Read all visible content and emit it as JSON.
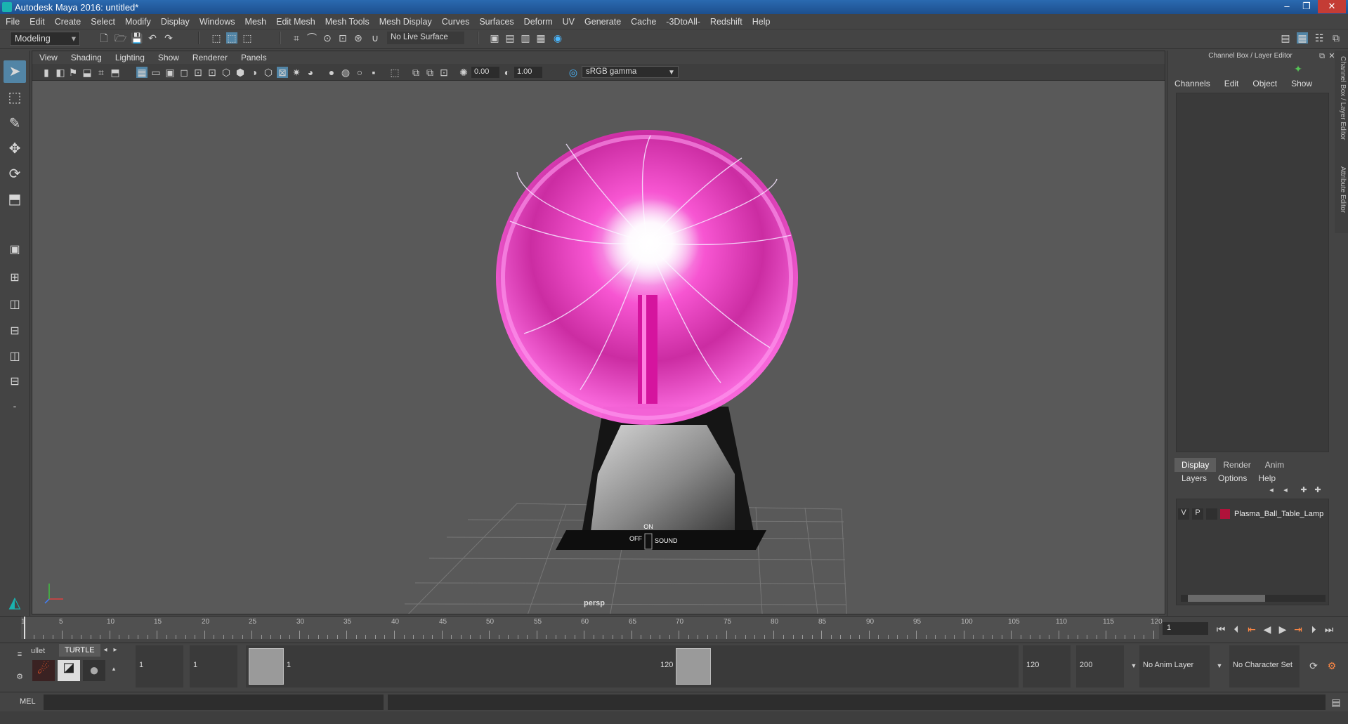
{
  "title": "Autodesk Maya 2016: untitled*",
  "menus": [
    "File",
    "Edit",
    "Create",
    "Select",
    "Modify",
    "Display",
    "Windows",
    "Mesh",
    "Edit Mesh",
    "Mesh Tools",
    "Mesh Display",
    "Curves",
    "Surfaces",
    "Deform",
    "UV",
    "Generate",
    "Cache",
    "-3DtoAll-",
    "Redshift",
    "Help"
  ],
  "statusline": {
    "mode": "Modeling",
    "live_surface": "No Live Surface"
  },
  "viewport": {
    "menus": [
      "View",
      "Shading",
      "Lighting",
      "Show",
      "Renderer",
      "Panels"
    ],
    "exposure": "0.00",
    "gamma_value": "1.00",
    "color_space": "sRGB gamma",
    "camera": "persp",
    "model_labels": {
      "on": "ON",
      "off": "OFF",
      "sound": "SOUND"
    }
  },
  "channel_box": {
    "title": "Channel Box / Layer Editor",
    "menus": [
      "Channels",
      "Edit",
      "Object",
      "Show"
    ],
    "side_tabs": [
      "Channel Box / Layer Editor",
      "Attribute Editor"
    ]
  },
  "layer_editor": {
    "tabs": [
      "Display",
      "Render",
      "Anim"
    ],
    "menus": [
      "Layers",
      "Options",
      "Help"
    ],
    "layer": {
      "v": "V",
      "p": "P",
      "name": "Plasma_Ball_Table_Lamp",
      "color": "#b0123a"
    }
  },
  "timeline": {
    "ticks": [
      "1",
      "5",
      "10",
      "15",
      "20",
      "25",
      "30",
      "35",
      "40",
      "45",
      "50",
      "55",
      "60",
      "65",
      "70",
      "75",
      "80",
      "85",
      "90",
      "95",
      "100",
      "105",
      "110",
      "115",
      "120"
    ],
    "current_frame": "1"
  },
  "range": {
    "shelf_tabs": [
      "ullet",
      "TURTLE"
    ],
    "start": "1",
    "playback_start": "1",
    "slider_start": "1",
    "slider_end": "120",
    "playback_end": "120",
    "end": "200",
    "anim_layer": "No Anim Layer",
    "character_set": "No Character Set"
  },
  "cmdline": {
    "label": "MEL"
  },
  "colors": {
    "accent": "#5285a6",
    "titlebar": "#1d4f8e",
    "plasma": "#ff3fc8"
  }
}
